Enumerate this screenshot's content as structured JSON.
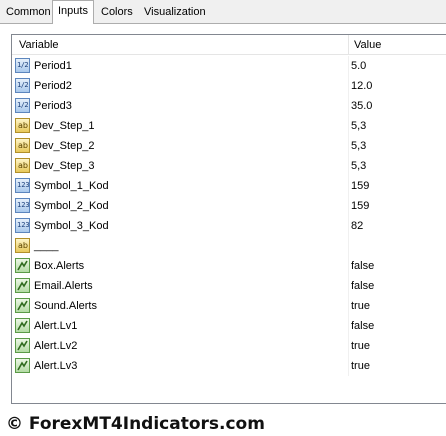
{
  "tabs": [
    "Common",
    "Inputs",
    "Colors",
    "Visualization"
  ],
  "active_tab": "Inputs",
  "table": {
    "headers": {
      "variable": "Variable",
      "value": "Value"
    },
    "rows": [
      {
        "type": "double",
        "name": "Period1",
        "value": "5.0"
      },
      {
        "type": "double",
        "name": "Period2",
        "value": "12.0"
      },
      {
        "type": "double",
        "name": "Period3",
        "value": "35.0"
      },
      {
        "type": "string",
        "name": "Dev_Step_1",
        "value": "5,3"
      },
      {
        "type": "string",
        "name": "Dev_Step_2",
        "value": "5,3"
      },
      {
        "type": "string",
        "name": "Dev_Step_3",
        "value": "5,3"
      },
      {
        "type": "int",
        "name": "Symbol_1_Kod",
        "value": "159"
      },
      {
        "type": "int",
        "name": "Symbol_2_Kod",
        "value": "159"
      },
      {
        "type": "int",
        "name": "Symbol_3_Kod",
        "value": "82"
      },
      {
        "type": "string",
        "name": "____",
        "value": ""
      },
      {
        "type": "bool",
        "name": "Box.Alerts",
        "value": "false"
      },
      {
        "type": "bool",
        "name": "Email.Alerts",
        "value": "false"
      },
      {
        "type": "bool",
        "name": "Sound.Alerts",
        "value": "true"
      },
      {
        "type": "bool",
        "name": "Alert.Lv1",
        "value": "false"
      },
      {
        "type": "bool",
        "name": "Alert.Lv2",
        "value": "true"
      },
      {
        "type": "bool",
        "name": "Alert.Lv3",
        "value": "true"
      }
    ]
  },
  "icon_names": {
    "double": "double-type-icon",
    "string": "string-type-icon",
    "int": "integer-type-icon",
    "bool": "boolean-type-icon"
  },
  "icon_glyphs": {
    "double": "1/2",
    "string": "ab",
    "int": "123"
  },
  "watermark": "© ForexMT4Indicators.com"
}
